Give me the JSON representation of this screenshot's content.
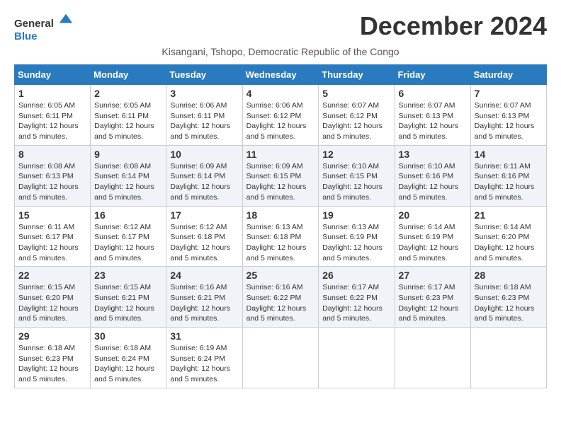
{
  "logo": {
    "general": "General",
    "blue": "Blue"
  },
  "title": "December 2024",
  "subtitle": "Kisangani, Tshopo, Democratic Republic of the Congo",
  "weekdays": [
    "Sunday",
    "Monday",
    "Tuesday",
    "Wednesday",
    "Thursday",
    "Friday",
    "Saturday"
  ],
  "weeks": [
    [
      {
        "day": "1",
        "sunrise": "6:05 AM",
        "sunset": "6:11 PM",
        "daylight": "12 hours and 5 minutes."
      },
      {
        "day": "2",
        "sunrise": "6:05 AM",
        "sunset": "6:11 PM",
        "daylight": "12 hours and 5 minutes."
      },
      {
        "day": "3",
        "sunrise": "6:06 AM",
        "sunset": "6:11 PM",
        "daylight": "12 hours and 5 minutes."
      },
      {
        "day": "4",
        "sunrise": "6:06 AM",
        "sunset": "6:12 PM",
        "daylight": "12 hours and 5 minutes."
      },
      {
        "day": "5",
        "sunrise": "6:07 AM",
        "sunset": "6:12 PM",
        "daylight": "12 hours and 5 minutes."
      },
      {
        "day": "6",
        "sunrise": "6:07 AM",
        "sunset": "6:13 PM",
        "daylight": "12 hours and 5 minutes."
      },
      {
        "day": "7",
        "sunrise": "6:07 AM",
        "sunset": "6:13 PM",
        "daylight": "12 hours and 5 minutes."
      }
    ],
    [
      {
        "day": "8",
        "sunrise": "6:08 AM",
        "sunset": "6:13 PM",
        "daylight": "12 hours and 5 minutes."
      },
      {
        "day": "9",
        "sunrise": "6:08 AM",
        "sunset": "6:14 PM",
        "daylight": "12 hours and 5 minutes."
      },
      {
        "day": "10",
        "sunrise": "6:09 AM",
        "sunset": "6:14 PM",
        "daylight": "12 hours and 5 minutes."
      },
      {
        "day": "11",
        "sunrise": "6:09 AM",
        "sunset": "6:15 PM",
        "daylight": "12 hours and 5 minutes."
      },
      {
        "day": "12",
        "sunrise": "6:10 AM",
        "sunset": "6:15 PM",
        "daylight": "12 hours and 5 minutes."
      },
      {
        "day": "13",
        "sunrise": "6:10 AM",
        "sunset": "6:16 PM",
        "daylight": "12 hours and 5 minutes."
      },
      {
        "day": "14",
        "sunrise": "6:11 AM",
        "sunset": "6:16 PM",
        "daylight": "12 hours and 5 minutes."
      }
    ],
    [
      {
        "day": "15",
        "sunrise": "6:11 AM",
        "sunset": "6:17 PM",
        "daylight": "12 hours and 5 minutes."
      },
      {
        "day": "16",
        "sunrise": "6:12 AM",
        "sunset": "6:17 PM",
        "daylight": "12 hours and 5 minutes."
      },
      {
        "day": "17",
        "sunrise": "6:12 AM",
        "sunset": "6:18 PM",
        "daylight": "12 hours and 5 minutes."
      },
      {
        "day": "18",
        "sunrise": "6:13 AM",
        "sunset": "6:18 PM",
        "daylight": "12 hours and 5 minutes."
      },
      {
        "day": "19",
        "sunrise": "6:13 AM",
        "sunset": "6:19 PM",
        "daylight": "12 hours and 5 minutes."
      },
      {
        "day": "20",
        "sunrise": "6:14 AM",
        "sunset": "6:19 PM",
        "daylight": "12 hours and 5 minutes."
      },
      {
        "day": "21",
        "sunrise": "6:14 AM",
        "sunset": "6:20 PM",
        "daylight": "12 hours and 5 minutes."
      }
    ],
    [
      {
        "day": "22",
        "sunrise": "6:15 AM",
        "sunset": "6:20 PM",
        "daylight": "12 hours and 5 minutes."
      },
      {
        "day": "23",
        "sunrise": "6:15 AM",
        "sunset": "6:21 PM",
        "daylight": "12 hours and 5 minutes."
      },
      {
        "day": "24",
        "sunrise": "6:16 AM",
        "sunset": "6:21 PM",
        "daylight": "12 hours and 5 minutes."
      },
      {
        "day": "25",
        "sunrise": "6:16 AM",
        "sunset": "6:22 PM",
        "daylight": "12 hours and 5 minutes."
      },
      {
        "day": "26",
        "sunrise": "6:17 AM",
        "sunset": "6:22 PM",
        "daylight": "12 hours and 5 minutes."
      },
      {
        "day": "27",
        "sunrise": "6:17 AM",
        "sunset": "6:23 PM",
        "daylight": "12 hours and 5 minutes."
      },
      {
        "day": "28",
        "sunrise": "6:18 AM",
        "sunset": "6:23 PM",
        "daylight": "12 hours and 5 minutes."
      }
    ],
    [
      {
        "day": "29",
        "sunrise": "6:18 AM",
        "sunset": "6:23 PM",
        "daylight": "12 hours and 5 minutes."
      },
      {
        "day": "30",
        "sunrise": "6:18 AM",
        "sunset": "6:24 PM",
        "daylight": "12 hours and 5 minutes."
      },
      {
        "day": "31",
        "sunrise": "6:19 AM",
        "sunset": "6:24 PM",
        "daylight": "12 hours and 5 minutes."
      },
      null,
      null,
      null,
      null
    ]
  ],
  "labels": {
    "sunrise": "Sunrise: ",
    "sunset": "Sunset: ",
    "daylight": "Daylight: "
  }
}
